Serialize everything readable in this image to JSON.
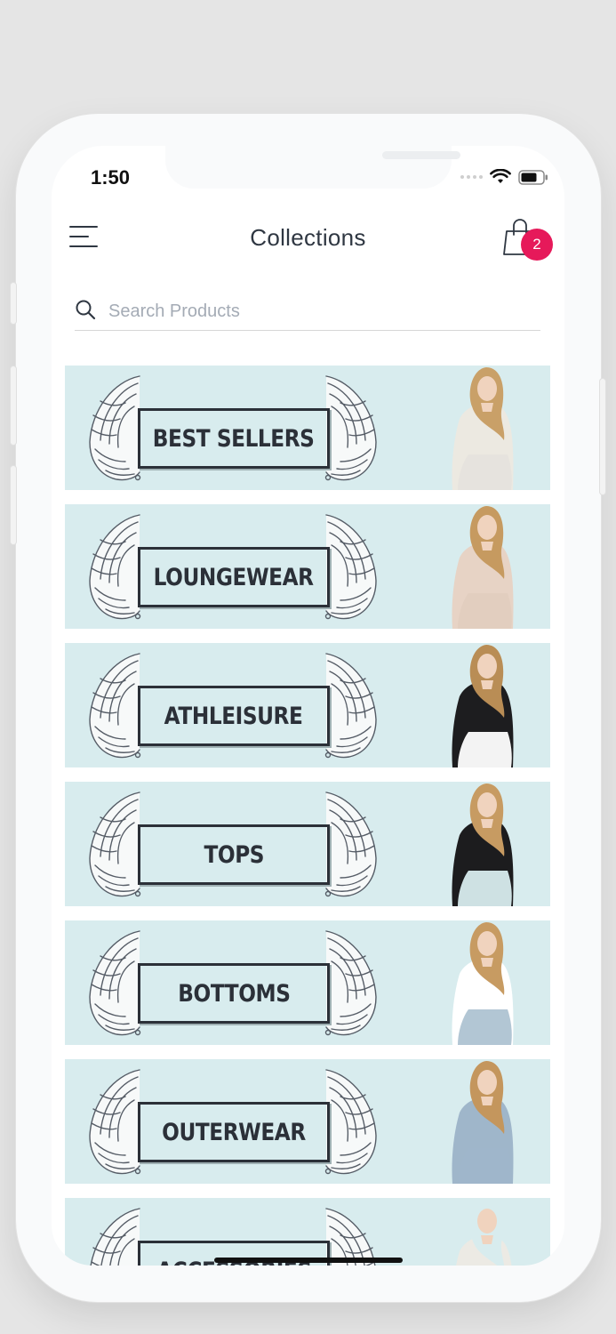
{
  "status_bar": {
    "time": "1:50"
  },
  "header": {
    "title": "Collections",
    "cart_count": "2"
  },
  "search": {
    "placeholder": "Search Products",
    "value": ""
  },
  "collections": [
    {
      "label": "BEST SELLERS",
      "top": "#ece9e1",
      "bottom": "#e6e3dd",
      "hair": "#c9a068"
    },
    {
      "label": "LOUNGEWEAR",
      "top": "#e7d3c5",
      "bottom": "#e2cdbf",
      "hair": "#c69a60"
    },
    {
      "label": "ATHLEISURE",
      "top": "#1d1d1f",
      "bottom": "#ffffff",
      "hair": "#b98d55"
    },
    {
      "label": "TOPS",
      "top": "#1c1c1e",
      "bottom": "#d8ecee",
      "hair": "#c79b62"
    },
    {
      "label": "BOTTOMS",
      "top": "#ffffff",
      "bottom": "#aec3d2",
      "hair": "#c79b62"
    },
    {
      "label": "OUTERWEAR",
      "top": "#9fb6ca",
      "bottom": "#9fb6ca",
      "hair": "#c4965d"
    },
    {
      "label": "ACCESSORIES",
      "top": "#eceae4",
      "bottom": "#d9c9b6",
      "hair": "#d8ecee"
    }
  ],
  "colors": {
    "banner_bg": "#d8ecee",
    "badge": "#e6195a",
    "text_dark": "#2f3742",
    "page_bg": "#e5e5e5"
  },
  "icons": {
    "menu": "hamburger-menu-icon",
    "cart": "shopping-bag-icon",
    "search": "search-icon",
    "wifi": "wifi-icon",
    "battery": "battery-icon",
    "signal": "signal-icon"
  }
}
